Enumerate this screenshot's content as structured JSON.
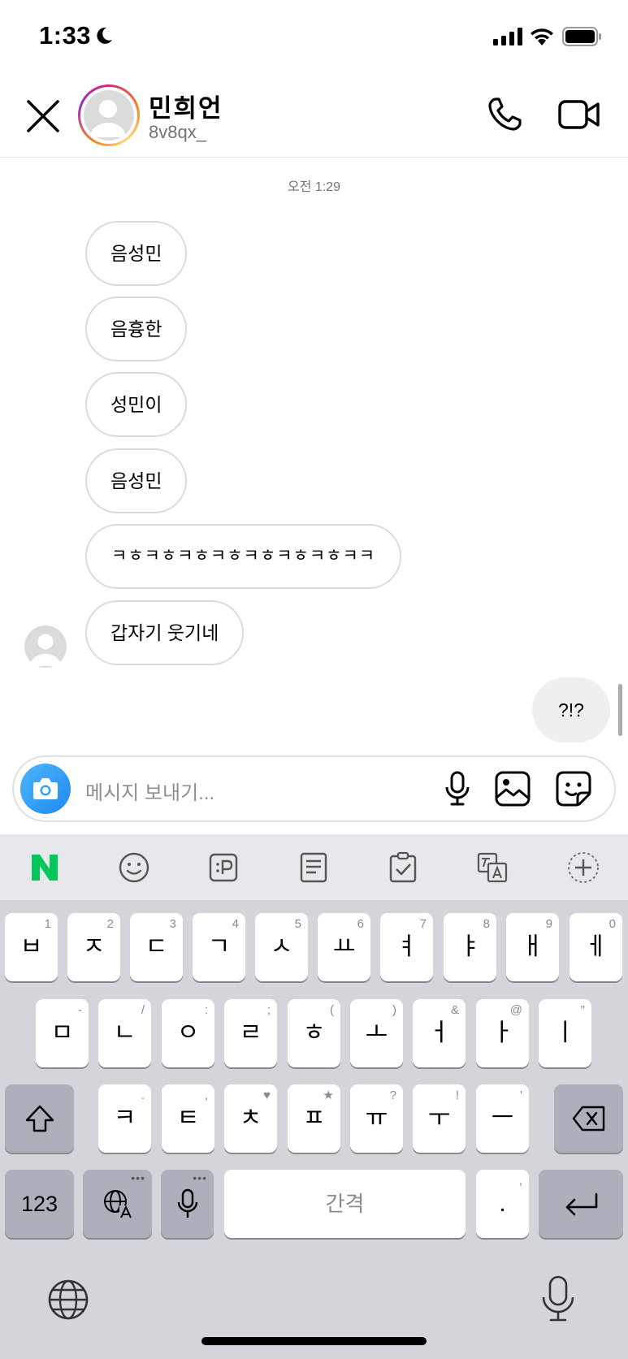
{
  "status_bar": {
    "time": "1:33"
  },
  "header": {
    "name": "민희언",
    "username": "8v8qx_"
  },
  "chat": {
    "timestamp": "오전 1:29",
    "received": [
      "음성민",
      "음흉한",
      "성민이",
      "음성민",
      "ㅋㅎㅋㅎㅋㅎㅋㅎㅋㅎㅋㅎㅋㅎㅋㅋ",
      "갑자기 웃기네"
    ],
    "sent": [
      "?!?"
    ]
  },
  "composer": {
    "placeholder": "메시지 보내기..."
  },
  "keyboard": {
    "toolbar": [
      "naver-icon",
      "emoji-icon",
      "clipboard-p-icon",
      "memo-icon",
      "checklist-icon",
      "translate-icon",
      "add-icon"
    ],
    "row1": [
      {
        "k": "ㅂ",
        "h": "1"
      },
      {
        "k": "ㅈ",
        "h": "2"
      },
      {
        "k": "ㄷ",
        "h": "3"
      },
      {
        "k": "ㄱ",
        "h": "4"
      },
      {
        "k": "ㅅ",
        "h": "5"
      },
      {
        "k": "ㅛ",
        "h": "6"
      },
      {
        "k": "ㅕ",
        "h": "7"
      },
      {
        "k": "ㅑ",
        "h": "8"
      },
      {
        "k": "ㅐ",
        "h": "9"
      },
      {
        "k": "ㅔ",
        "h": "0"
      }
    ],
    "row2": [
      {
        "k": "ㅁ",
        "h": "-"
      },
      {
        "k": "ㄴ",
        "h": "/"
      },
      {
        "k": "ㅇ",
        "h": ":"
      },
      {
        "k": "ㄹ",
        "h": ";"
      },
      {
        "k": "ㅎ",
        "h": "("
      },
      {
        "k": "ㅗ",
        "h": ")"
      },
      {
        "k": "ㅓ",
        "h": "&"
      },
      {
        "k": "ㅏ",
        "h": "@"
      },
      {
        "k": "ㅣ",
        "h": "\""
      }
    ],
    "row3": [
      {
        "k": "ㅋ",
        "h": "."
      },
      {
        "k": "ㅌ",
        "h": ","
      },
      {
        "k": "ㅊ",
        "h": "♥"
      },
      {
        "k": "ㅍ",
        "h": "★"
      },
      {
        "k": "ㅠ",
        "h": "?"
      },
      {
        "k": "ㅜ",
        "h": "!"
      },
      {
        "k": "ㅡ",
        "h": "'"
      }
    ],
    "num_key": "123",
    "space": "간격",
    "period": ".",
    "period_hint": ","
  }
}
